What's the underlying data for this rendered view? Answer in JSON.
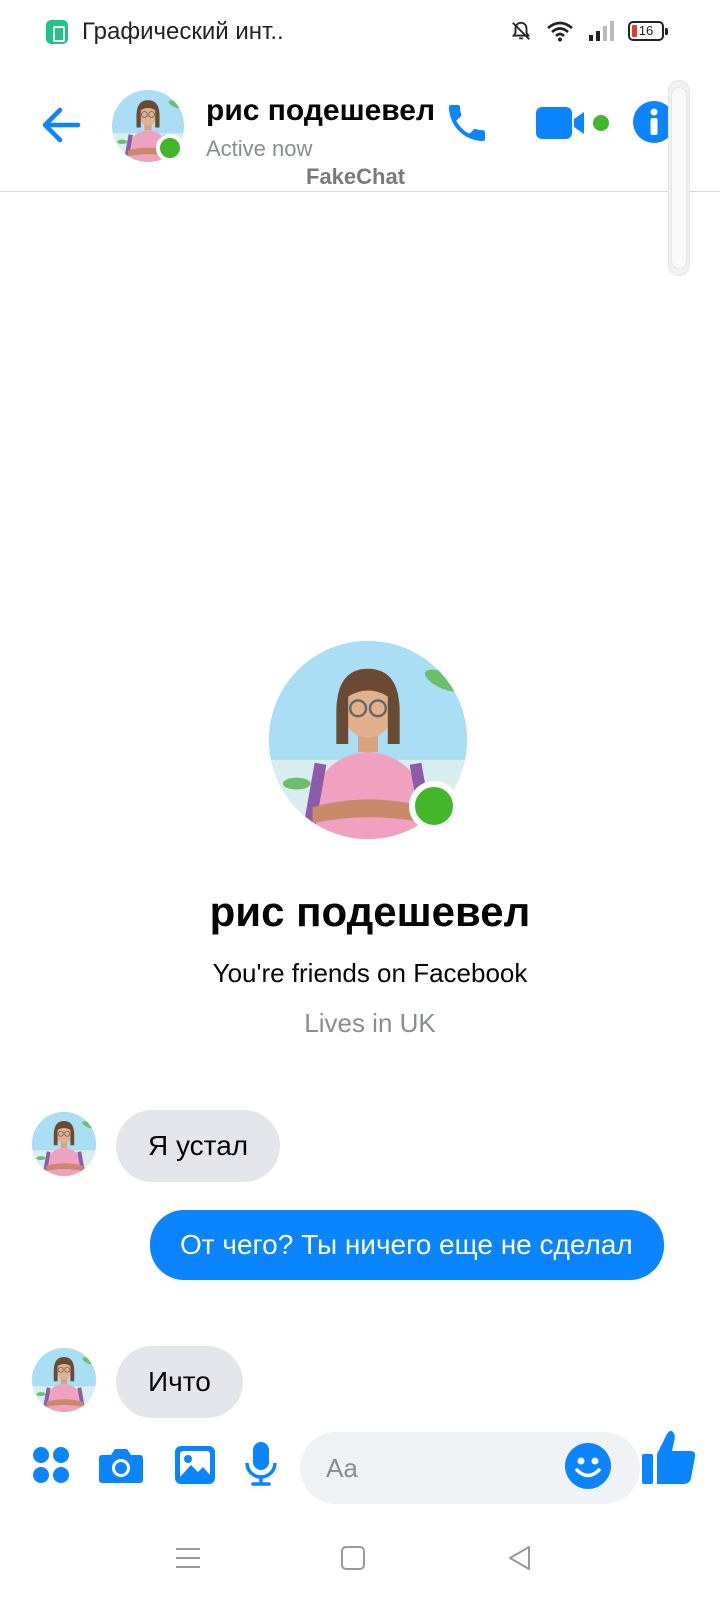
{
  "status_bar": {
    "app_title": "Графический инт..",
    "battery": "16",
    "icons": [
      "app-icon",
      "mute-bell-icon",
      "wifi-icon",
      "signal-icon",
      "battery-icon"
    ]
  },
  "header": {
    "contact_name": "рис подешевел",
    "status": "Active now",
    "watermark": "FakeChat",
    "icons": [
      "back-arrow-icon",
      "phone-icon",
      "video-camera-icon",
      "info-icon"
    ]
  },
  "profile": {
    "name": "рис подешевел",
    "friends_line": "You're friends on Facebook",
    "lives_line": "Lives in UK"
  },
  "messages": [
    {
      "direction": "incoming",
      "text": "Я устал"
    },
    {
      "direction": "outgoing",
      "text": "От чего? Ты ничего еще не сделал"
    },
    {
      "direction": "incoming",
      "text": "Ичто"
    }
  ],
  "composer": {
    "placeholder": "Aa",
    "icons": [
      "apps-icon",
      "camera-icon",
      "gallery-icon",
      "microphone-icon",
      "emoji-icon",
      "thumbs-up-icon"
    ]
  },
  "colors": {
    "accent": "#0a84ff",
    "online": "#42b72a",
    "incoming_bubble": "#e4e6eb",
    "secondary_text": "#8a8d91"
  }
}
